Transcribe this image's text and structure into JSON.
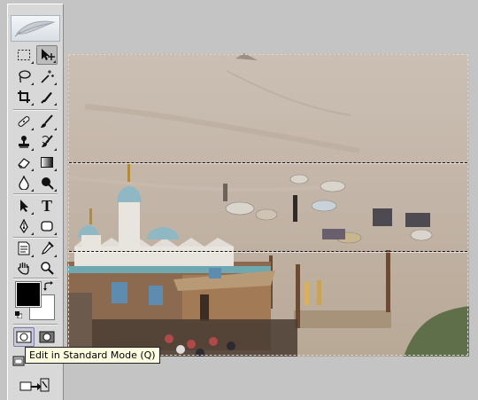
{
  "app": "Adobe Photoshop",
  "toolbox": {
    "header_icon": "feather-icon",
    "tools": [
      {
        "name": "rectangular-marquee-tool",
        "icon": "dashed-rectangle-icon"
      },
      {
        "name": "move-tool",
        "icon": "move-arrow-icon",
        "selected": true
      },
      {
        "name": "lasso-tool",
        "icon": "lasso-icon"
      },
      {
        "name": "magic-wand-tool",
        "icon": "magic-wand-icon"
      },
      {
        "name": "crop-tool",
        "icon": "crop-icon"
      },
      {
        "name": "slice-tool",
        "icon": "slice-knife-icon"
      },
      {
        "name": "healing-brush-tool",
        "icon": "bandage-icon"
      },
      {
        "name": "brush-tool",
        "icon": "brush-icon"
      },
      {
        "name": "clone-stamp-tool",
        "icon": "stamp-icon"
      },
      {
        "name": "history-brush-tool",
        "icon": "history-brush-icon"
      },
      {
        "name": "eraser-tool",
        "icon": "eraser-icon"
      },
      {
        "name": "gradient-tool",
        "icon": "gradient-icon"
      },
      {
        "name": "blur-tool",
        "icon": "drop-icon"
      },
      {
        "name": "dodge-tool",
        "icon": "dodge-icon"
      },
      {
        "name": "path-selection-tool",
        "icon": "arrow-cursor-icon"
      },
      {
        "name": "type-tool",
        "icon": "type-t-icon",
        "glyph": "T"
      },
      {
        "name": "pen-tool",
        "icon": "pen-nib-icon"
      },
      {
        "name": "shape-tool",
        "icon": "rounded-rectangle-icon"
      },
      {
        "name": "notes-tool",
        "icon": "note-icon"
      },
      {
        "name": "eyedropper-tool",
        "icon": "eyedropper-icon"
      },
      {
        "name": "hand-tool",
        "icon": "hand-icon"
      },
      {
        "name": "zoom-tool",
        "icon": "magnifier-icon"
      }
    ],
    "colors": {
      "foreground": "#000000",
      "background": "#ffffff"
    },
    "quick_mask": {
      "standard_mode_selected": true
    }
  },
  "tooltip": {
    "text": "Edit in Standard Mode (Q)"
  },
  "document": {
    "selection": "active marquee with quick-mask band lines"
  }
}
